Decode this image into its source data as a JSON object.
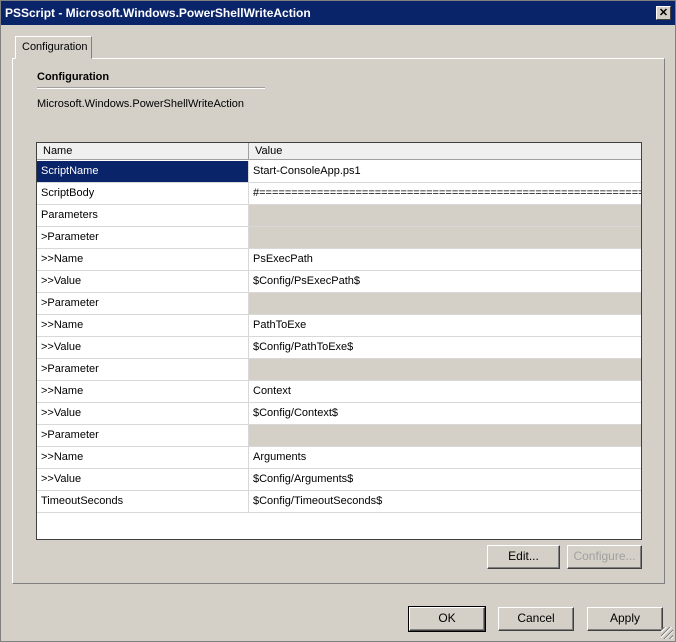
{
  "window": {
    "title": "PSScript - Microsoft.Windows.PowerShellWriteAction",
    "close_label": "✕"
  },
  "tabs": [
    {
      "label": "Configuration"
    }
  ],
  "section": {
    "title": "Configuration",
    "module_name": "Microsoft.Windows.PowerShellWriteAction"
  },
  "grid": {
    "columns": [
      "Name",
      "Value"
    ],
    "rows": [
      {
        "name": "ScriptName",
        "value": "Start-ConsoleApp.ps1",
        "selected": true,
        "empty": false
      },
      {
        "name": "ScriptBody",
        "value": "#==============================================================...",
        "selected": false,
        "empty": false
      },
      {
        "name": "Parameters",
        "value": "",
        "selected": false,
        "empty": true
      },
      {
        "name": ">Parameter",
        "value": "",
        "selected": false,
        "empty": true
      },
      {
        "name": ">>Name",
        "value": "PsExecPath",
        "selected": false,
        "empty": false
      },
      {
        "name": ">>Value",
        "value": "$Config/PsExecPath$",
        "selected": false,
        "empty": false
      },
      {
        "name": ">Parameter",
        "value": "",
        "selected": false,
        "empty": true
      },
      {
        "name": ">>Name",
        "value": "PathToExe",
        "selected": false,
        "empty": false
      },
      {
        "name": ">>Value",
        "value": "$Config/PathToExe$",
        "selected": false,
        "empty": false
      },
      {
        "name": ">Parameter",
        "value": "",
        "selected": false,
        "empty": true
      },
      {
        "name": ">>Name",
        "value": "Context",
        "selected": false,
        "empty": false
      },
      {
        "name": ">>Value",
        "value": "$Config/Context$",
        "selected": false,
        "empty": false
      },
      {
        "name": ">Parameter",
        "value": "",
        "selected": false,
        "empty": true
      },
      {
        "name": ">>Name",
        "value": "Arguments",
        "selected": false,
        "empty": false
      },
      {
        "name": ">>Value",
        "value": "$Config/Arguments$",
        "selected": false,
        "empty": false
      },
      {
        "name": "TimeoutSeconds",
        "value": "$Config/TimeoutSeconds$",
        "selected": false,
        "empty": false
      }
    ]
  },
  "buttons": {
    "edit": "Edit...",
    "configure": "Configure...",
    "ok": "OK",
    "cancel": "Cancel",
    "apply": "Apply"
  },
  "colors": {
    "titlebar": "#0a246a",
    "selection": "#0a246a",
    "dialog_bg": "#d4d0c8"
  }
}
